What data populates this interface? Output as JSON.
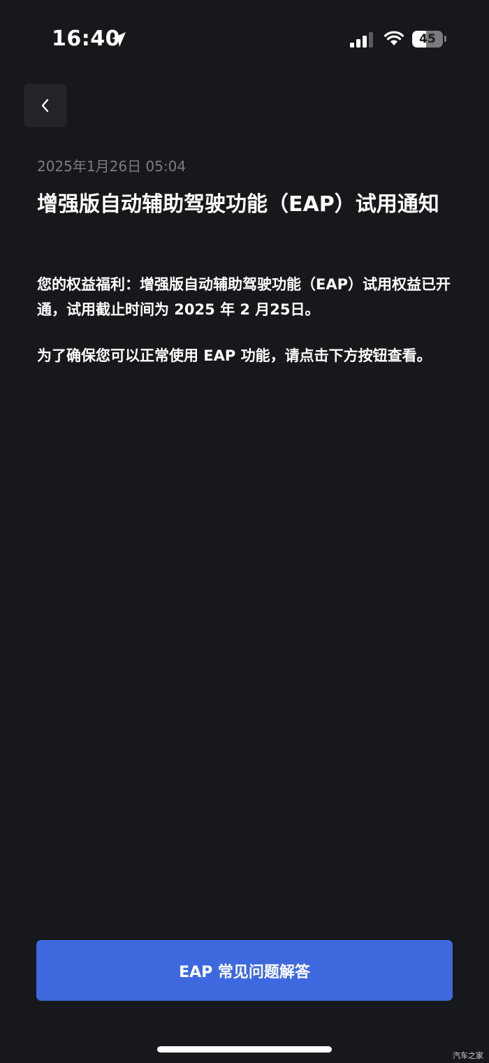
{
  "status_bar": {
    "time": "16:40",
    "battery_level": "45",
    "battery_fraction": 0.45,
    "icons": [
      "location-arrow-icon",
      "cellular-signal-icon",
      "wifi-icon",
      "battery-icon"
    ]
  },
  "nav": {
    "back_icon": "chevron-left-icon"
  },
  "notice": {
    "date": "2025年1月26日 05:04",
    "title": "增强版自动辅助驾驶功能（EAP）试用通知",
    "paragraph_1": "您的权益福利：增强版自动辅助驾驶功能（EAP）试用权益已开通，试用截止时间为 2025 年 2 月25日。",
    "paragraph_2": "为了确保您可以正常使用 EAP 功能，请点击下方按钮查看。"
  },
  "actions": {
    "faq_button_label": "EAP 常见问题解答"
  },
  "watermark": "汽车之家",
  "colors": {
    "background": "#17181b",
    "primary_button": "#3e69de",
    "secondary_text": "#7c7d80",
    "back_button_bg": "#232427"
  }
}
